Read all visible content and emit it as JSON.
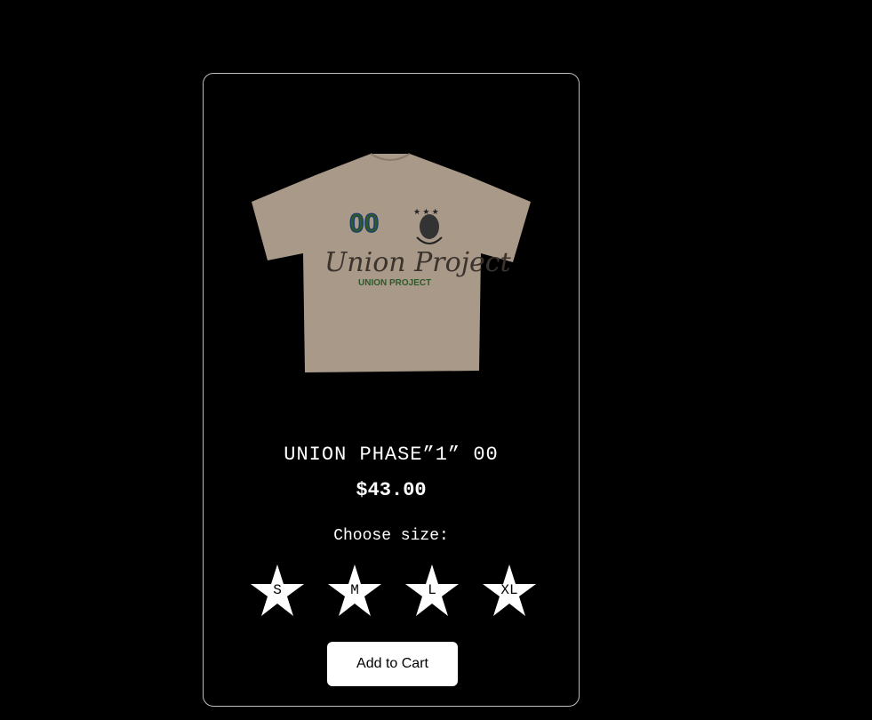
{
  "product": {
    "name": "UNION PHASE”1” 00",
    "price": "$43.00",
    "image": {
      "shirt_color": "#a99989",
      "number_print": "00",
      "script_print": "Union Project",
      "small_print": "UNION PROJECT"
    }
  },
  "size_selector": {
    "label": "Choose size:",
    "options": [
      "S",
      "M",
      "L",
      "XL"
    ]
  },
  "cart": {
    "add_label": "Add to Cart"
  }
}
